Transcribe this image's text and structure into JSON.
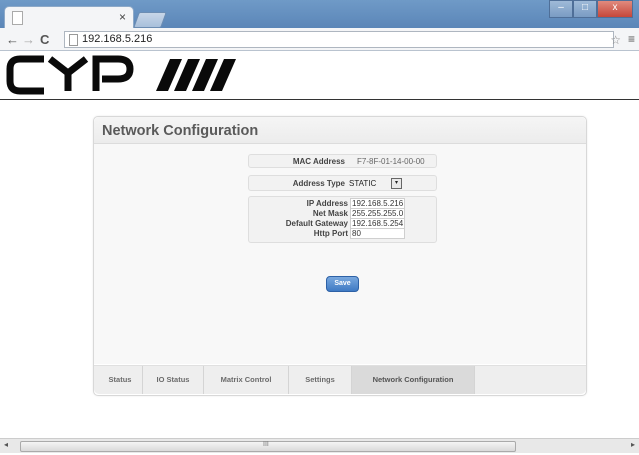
{
  "browser": {
    "tab_close": "×",
    "url": "192.168.5.216",
    "back": "←",
    "forward": "→",
    "reload": "C",
    "star": "☆",
    "menu": "≡",
    "win_minimize": "–",
    "win_maximize": "□",
    "win_close": "x"
  },
  "logo": {
    "text": "CYP"
  },
  "panel": {
    "title": "Network Configuration",
    "mac": {
      "label": "MAC Address",
      "value": "F7-8F-01-14-00-00"
    },
    "address_type": {
      "label": "Address Type",
      "value": "STATIC",
      "arrow": "▾"
    },
    "ip": {
      "label": "IP Address",
      "value": "192.168.5.216"
    },
    "mask": {
      "label": "Net Mask",
      "value": "255.255.255.0"
    },
    "gateway": {
      "label": "Default Gateway",
      "value": "192.168.5.254"
    },
    "http_port": {
      "label": "Http Port",
      "value": "80"
    },
    "save_label": "Save"
  },
  "nav_tabs": [
    {
      "label": "Status",
      "active": false
    },
    {
      "label": "IO Status",
      "active": false
    },
    {
      "label": "Matrix Control",
      "active": false
    },
    {
      "label": "Settings",
      "active": false
    },
    {
      "label": "Network Configuration",
      "active": true
    }
  ],
  "scrollbar": {
    "left_arrow": "◂",
    "right_arrow": "▸",
    "grip": "III"
  },
  "colors": {
    "accent": "#4a84cc",
    "title_text": "#5a5a5a"
  }
}
